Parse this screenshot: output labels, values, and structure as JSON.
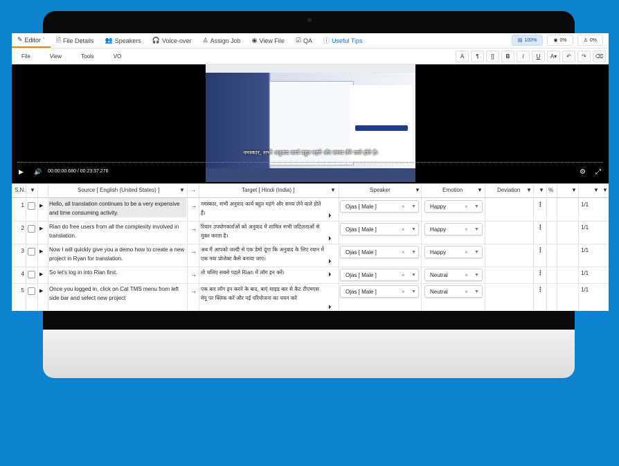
{
  "tabs": [
    {
      "label": "Editor",
      "icon": "edit-icon",
      "active": true
    },
    {
      "label": "File Details",
      "icon": "file-icon"
    },
    {
      "label": "Speakers",
      "icon": "speakers-icon"
    },
    {
      "label": "Voice-over",
      "icon": "headphones-icon"
    },
    {
      "label": "Assign Job",
      "icon": "assign-icon"
    },
    {
      "label": "View File",
      "icon": "eye-icon"
    },
    {
      "label": "QA",
      "icon": "qa-icon"
    },
    {
      "label": "Useful Tips",
      "icon": "info-icon",
      "link": true
    }
  ],
  "status": {
    "progress": "100%",
    "viewed": "0%",
    "assigned": "0%"
  },
  "menu": [
    "File",
    "View",
    "Tools",
    "VO"
  ],
  "format_toolbar": [
    "A",
    "¶",
    "[]",
    "B",
    "I",
    "U",
    "A▾",
    "↶",
    "↷",
    "⌫"
  ],
  "video": {
    "subtitle": "नमस्कार, सभी अनुवाद कार्य बहुत महंगे और समय लेने वाले होते हैं।",
    "timecode": "00:00:00.680 / 00:23:37.276"
  },
  "grid_headers": {
    "sn": "S.N.",
    "source": "Source [ English (United States) ]",
    "target": "Target [ Hindi (India) ]",
    "speaker": "Speaker",
    "emotion": "Emotion",
    "deviation": "Deviation",
    "percent": "%"
  },
  "rows": [
    {
      "num": "1",
      "source": "Hello, all translation continues to be a very expensive and time consuming activity.",
      "target": "नमस्कार, सभी अनुवाद कार्य बहुत महंगे और समय लेने वाले होते हैं।",
      "speaker": "Ojas [ Male ]",
      "emotion": "Happy",
      "ratio": "1/1"
    },
    {
      "num": "2",
      "source": "Rian do free users from all the complexity involved in translation.",
      "target": "रियान उपयोगकर्ताओं को अनुवाद में शामिल सभी जटिलताओं से मुक्त करता है।",
      "speaker": "Ojas [ Male ]",
      "emotion": "Happy",
      "ratio": "1/1"
    },
    {
      "num": "3",
      "source": "Now I will quickly give you a demo how to create a new project in Ryan for translation.",
      "target": "अब मैं आपको जल्दी से एक डेमो दूंगा कि अनुवाद के लिए रयान में एक नया प्रोजेक्ट कैसे बनाया जाए।",
      "speaker": "Ojas [ Male ]",
      "emotion": "Happy",
      "ratio": "1/1"
    },
    {
      "num": "4",
      "source": "So let's log in into Rian first.",
      "target": "तो चलिए सबसे पहले Rian में लॉग इन करें।",
      "speaker": "Ojas [ Male ]",
      "emotion": "Neutral",
      "ratio": "1/1"
    },
    {
      "num": "5",
      "source": "Once you logged in, click on Cat TMS menu from left side bar and select new project",
      "target": "एक बार लॉग इन करने के बाद, बाएं साइड बार से कैट टीएमएस मेनू पर क्लिक करें और नई परियोजना का चयन करें",
      "speaker": "Ojas [ Male ]",
      "emotion": "Neutral",
      "ratio": "1/1"
    }
  ]
}
